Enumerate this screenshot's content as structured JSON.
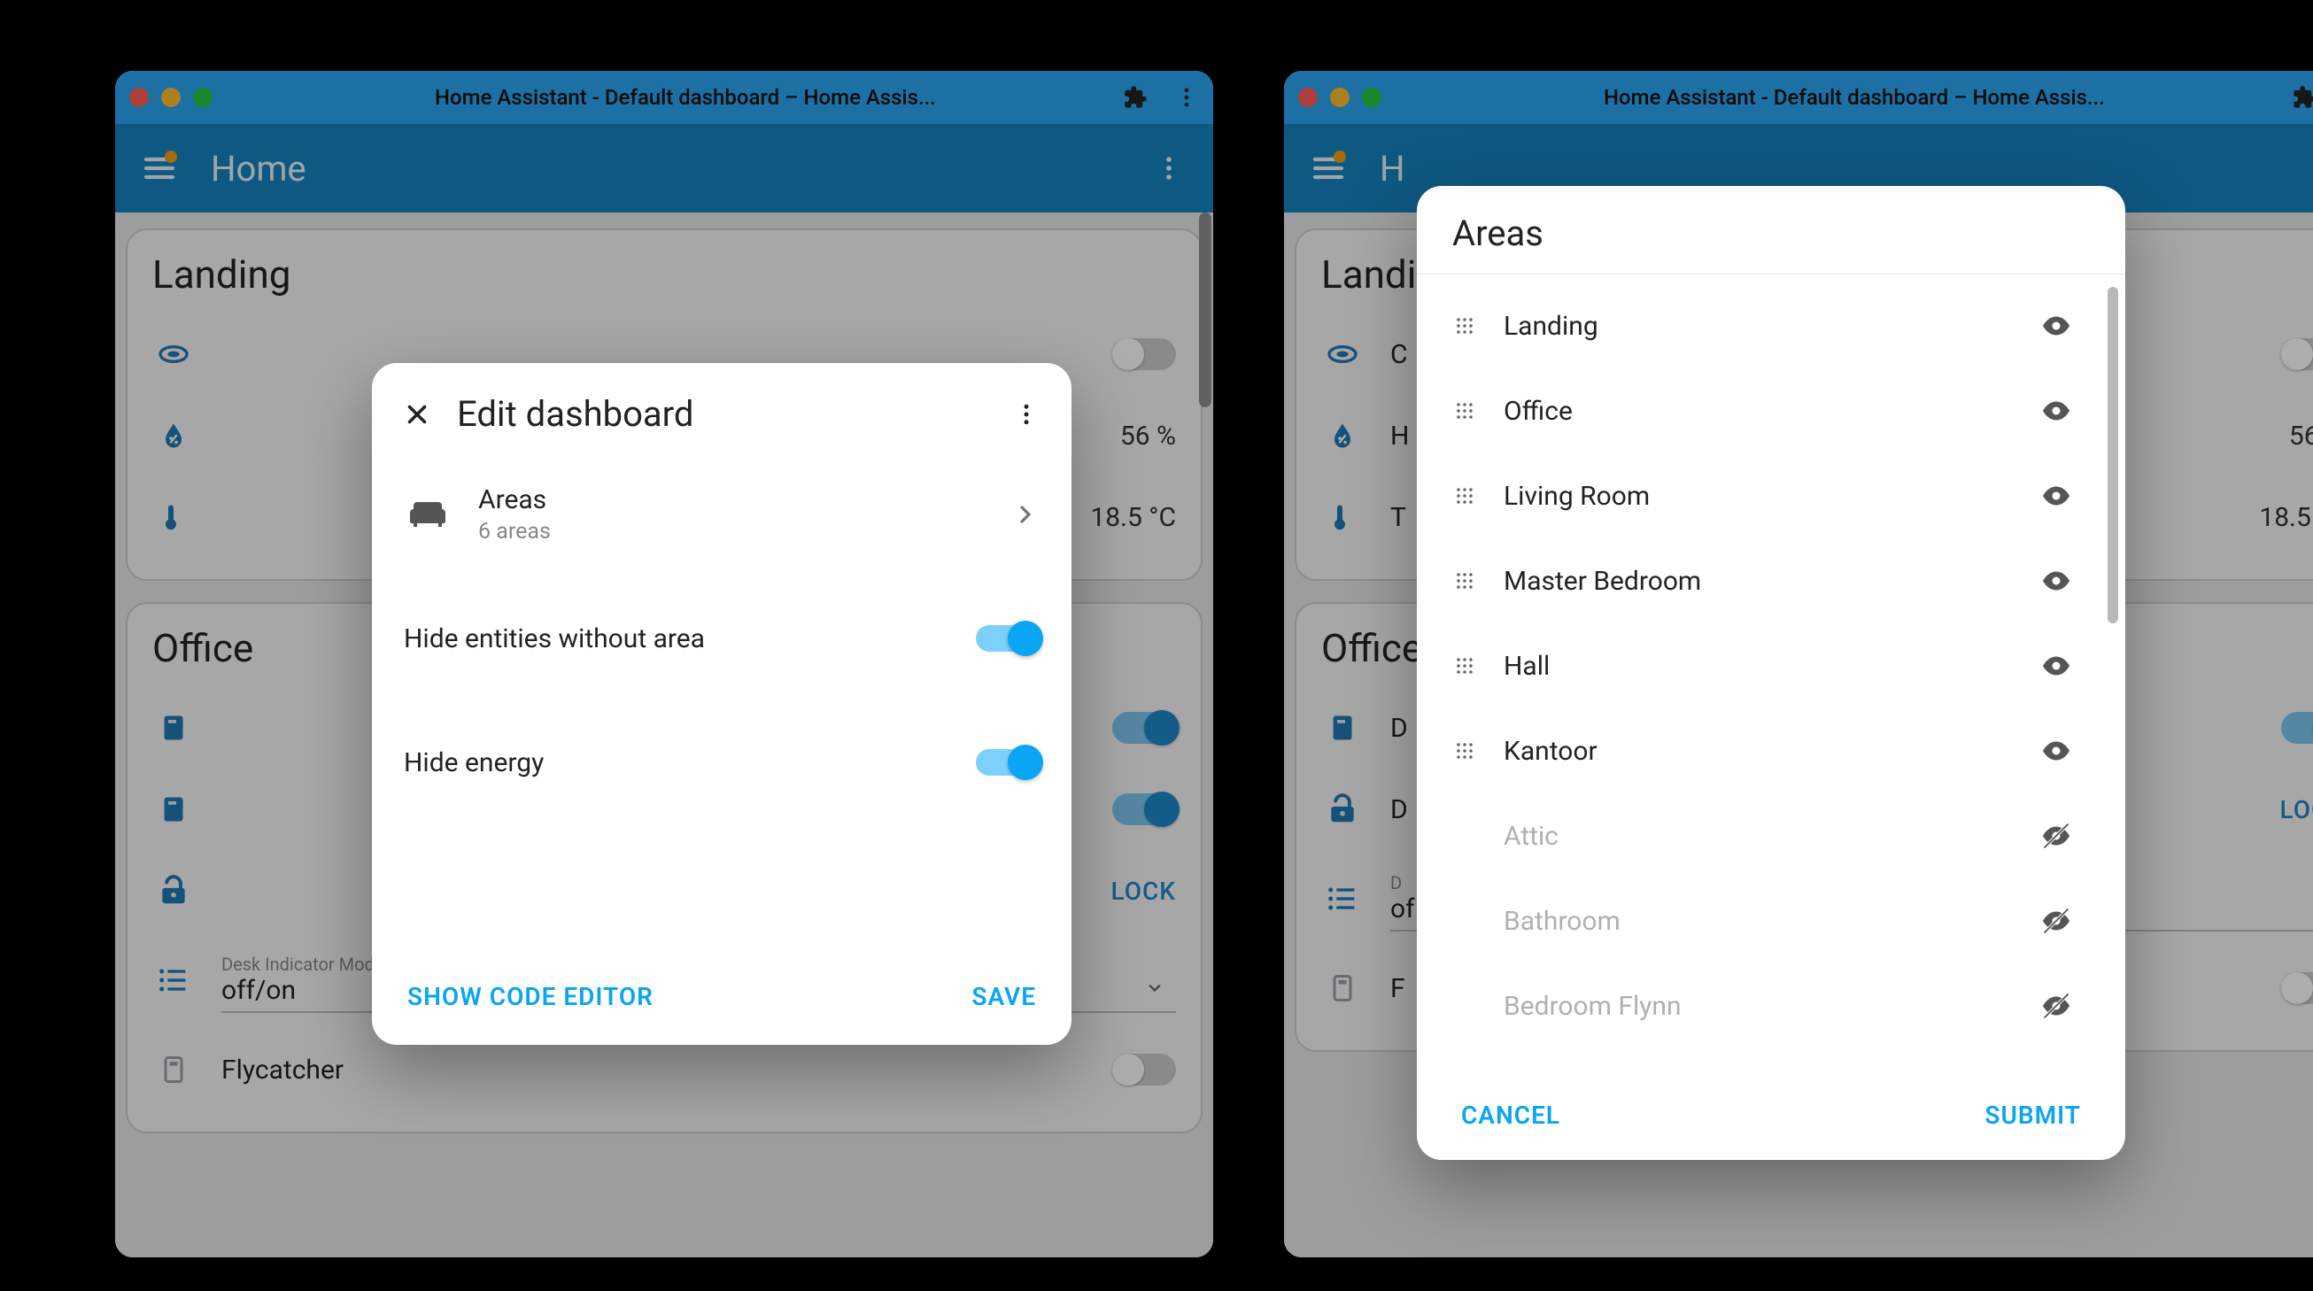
{
  "window_title": "Home Assistant - Default dashboard – Home Assis...",
  "appbar_title": "Home",
  "cards": {
    "landing": {
      "title": "Landing",
      "humidity": "56 %",
      "temperature": "18.5 °C"
    },
    "office": {
      "title": "Office",
      "lock_label": "LOCK",
      "select_caption": "Desk Indicator Mode",
      "select_value": "off/on",
      "flycatcher": "Flycatcher"
    }
  },
  "edit_modal": {
    "title": "Edit dashboard",
    "areas_label": "Areas",
    "areas_sub": "6 areas",
    "hide_entities_label": "Hide entities without area",
    "hide_energy_label": "Hide energy",
    "show_code": "SHOW CODE EDITOR",
    "save": "SAVE"
  },
  "areas_modal": {
    "title": "Areas",
    "items": [
      {
        "name": "Landing",
        "visible": true
      },
      {
        "name": "Office",
        "visible": true
      },
      {
        "name": "Living Room",
        "visible": true
      },
      {
        "name": "Master Bedroom",
        "visible": true
      },
      {
        "name": "Hall",
        "visible": true
      },
      {
        "name": "Kantoor",
        "visible": true
      },
      {
        "name": "Attic",
        "visible": false
      },
      {
        "name": "Bathroom",
        "visible": false
      },
      {
        "name": "Bedroom Flynn",
        "visible": false
      }
    ],
    "cancel": "CANCEL",
    "submit": "SUBMIT"
  }
}
